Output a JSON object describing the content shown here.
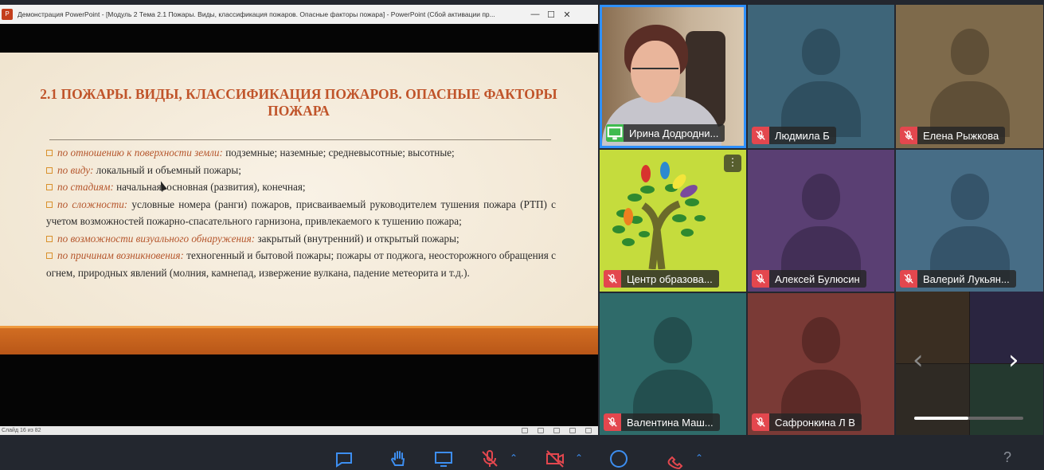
{
  "ppt": {
    "window_title": "Демонстрация PowerPoint - [Модуль 2 Тема 2.1 Пожары. Виды, классификация пожаров. Опасные факторы пожара] - PowerPoint (Сбой активации пр...",
    "app_icon": "P",
    "min_glyph": "—",
    "max_glyph": "☐",
    "close_glyph": "✕",
    "status_text": "Слайд 16 из 82"
  },
  "slide": {
    "title": "2.1 ПОЖАРЫ. ВИДЫ, КЛАССИФИКАЦИЯ ПОЖАРОВ. ОПАСНЫЕ ФАКТОРЫ ПОЖАРА",
    "items": [
      {
        "category": "по отношению к поверхности земли:",
        "text": " подземные; наземные; средневысотные; высотные;"
      },
      {
        "category": "по виду:",
        "text": " локальный и объемный пожары;"
      },
      {
        "category": "по стадиям:",
        "text": " начальная, основная (развития), конечная;"
      },
      {
        "category": "по сложности:",
        "text": " условные номера (ранги) пожаров, присваиваемый руководителем тушения пожара (РТП) с учетом возможностей пожарно-спасательного гарнизона, привлекаемого к тушению пожара;"
      },
      {
        "category": "по возможности визуального обнаружения:",
        "text": " закрытый (внутренний) и открытый пожары;"
      },
      {
        "category": "по причинам возникновения:",
        "text": " техногенный и бытовой пожары; пожары от поджога, неосторожного обращения с огнем, природных явлений (молния, камнепад, извержение вулкана, падение метеорита и т.д.)."
      }
    ]
  },
  "participants": [
    {
      "name": "Ирина Додродни...",
      "bg": "#8b7b66",
      "status": "sharing-screen"
    },
    {
      "name": "Людмила Б",
      "bg": "#3e6579",
      "status": "muted"
    },
    {
      "name": "Елена Рыжкова",
      "bg": "#7e6a4b",
      "status": "muted"
    },
    {
      "name": "Центр образова...",
      "bg": "#c5dc3d",
      "status": "muted"
    },
    {
      "name": "Алексей Булюсин",
      "bg": "#5a3f73",
      "status": "muted"
    },
    {
      "name": "Валерий Лукьян...",
      "bg": "#476d86",
      "status": "muted"
    },
    {
      "name": "Валентина Маш...",
      "bg": "#2f6b6a",
      "status": "muted"
    },
    {
      "name": "Сафронкина Л В",
      "bg": "#7a3a36",
      "status": "muted"
    }
  ],
  "more_glyph": "⋮",
  "nav": {
    "prev": "‹",
    "next": "›"
  },
  "help": "?"
}
